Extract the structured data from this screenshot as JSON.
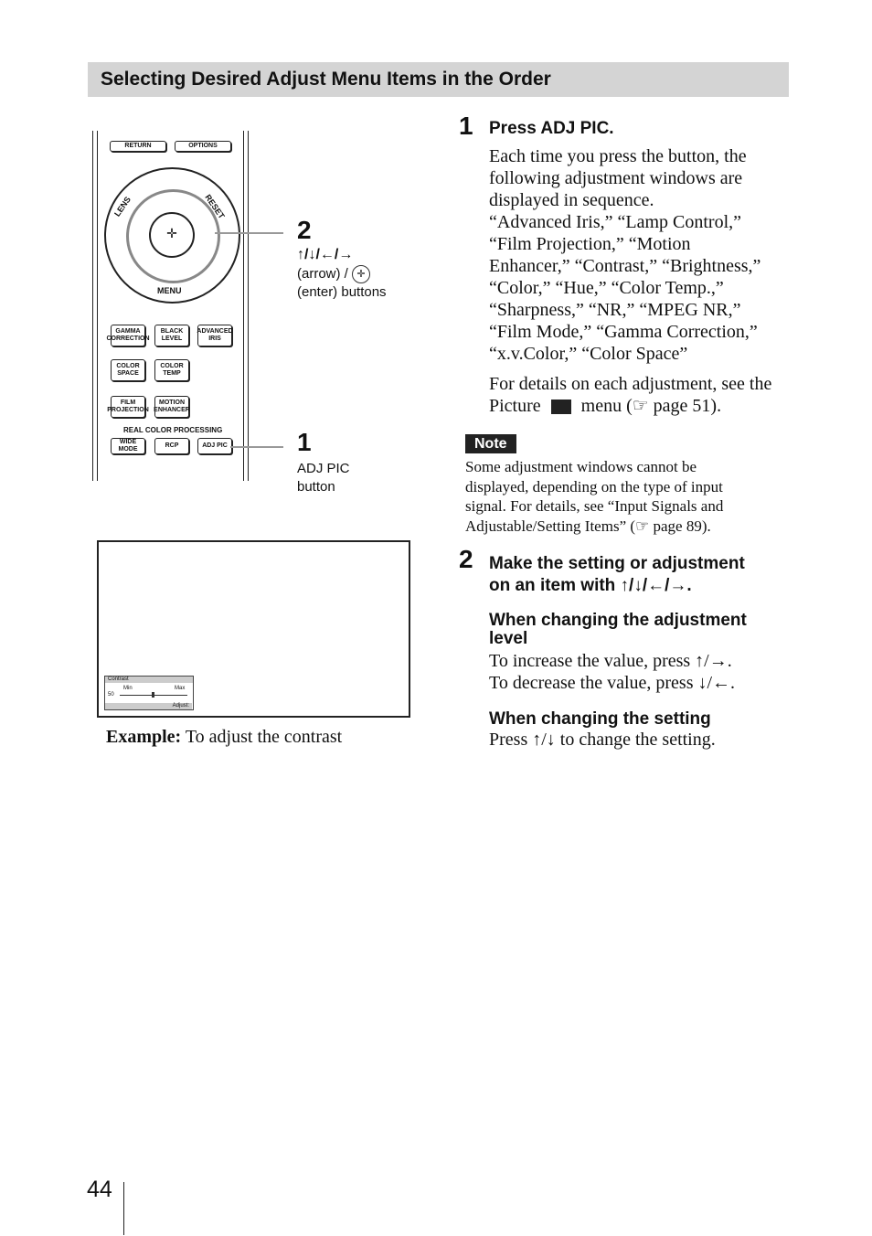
{
  "header": {
    "title": "Selecting Desired Adjust Menu Items in the Order"
  },
  "remote": {
    "buttons": [
      "RETURN",
      "OPTIONS",
      "GAMMA CORRECTION",
      "BLACK LEVEL",
      "ADVANCED IRIS",
      "COLOR SPACE",
      "COLOR TEMP",
      "FILM PROJECTION",
      "MOTION ENHANCER",
      "WIDE MODE",
      "RCP",
      "ADJ PIC"
    ],
    "ring": {
      "lens": "LENS",
      "reset": "RESET",
      "menu": "MENU"
    },
    "group_label": "REAL COLOR PROCESSING"
  },
  "callouts": [
    {
      "num": "2",
      "arrows": "↑/↓/←/→",
      "line1": "(arrow) /",
      "line2": "(enter) buttons"
    },
    {
      "num": "1",
      "line1": "ADJ PIC",
      "line2": "button"
    }
  ],
  "screen": {
    "title": "Contrast",
    "min": "Min",
    "max": "Max",
    "value": "50",
    "footer": "Adjust:",
    "value_fraction": 0.5
  },
  "example": {
    "bold": "Example:",
    "text": " To adjust the contrast"
  },
  "steps": [
    {
      "num": "1",
      "title": "Press ADJ PIC.",
      "lines": [
        "Each time you press the button, the",
        "following adjustment windows are",
        "displayed in sequence.",
        "“Advanced Iris,” “Lamp Control,”",
        "“Film Projection,” “Motion",
        "Enhancer,” “Contrast,” “Brightness,”",
        "“Color,” “Hue,” “Color Temp.,”",
        "“Sharpness,” “NR,” “MPEG NR,”",
        "“Film Mode,” “Gamma Correction,”",
        "“x.v.Color,” “Color Space”"
      ],
      "details1": "For details on each adjustment, see the",
      "details2a": "Picture",
      "details2b": "menu (☞ page 51)."
    },
    {
      "num": "2",
      "title1": "Make the setting or adjustment",
      "title2": "on an item with ↑/↓/←/→.",
      "sub1": "When changing the adjustment level",
      "inc": "To increase the value, press ↑/→.",
      "dec": "To decrease the value, press ↓/←.",
      "sub2": "When changing the setting",
      "press": "Press ↑/↓ to change the setting."
    }
  ],
  "note": {
    "label": "Note",
    "lines": [
      "Some adjustment windows cannot be",
      "displayed, depending on the type of input",
      "signal. For details, see “Input Signals and",
      "Adjustable/Setting Items” (☞ page 89)."
    ]
  },
  "page_number": "44"
}
